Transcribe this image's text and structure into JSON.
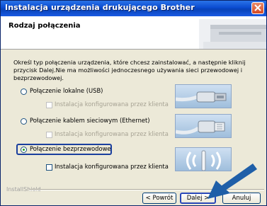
{
  "window": {
    "title": "Instalacja urządzenia drukującego Brother"
  },
  "header": {
    "title": "Rodzaj połączenia"
  },
  "description": "Określ typ połączenia urządzenia, które chcesz zainstalować, a następnie kliknij przycisk Dalej.Nie ma możliwości jednoczesnego używania sieci przewodowej i bezprzewodowej.",
  "options": [
    {
      "label": "Połączenie lokalne (USB)",
      "selected": false,
      "sub_label": "Instalacja konfigurowana przez klienta",
      "sub_enabled": false
    },
    {
      "label": "Połączenie kablem sieciowym (Ethernet)",
      "selected": false,
      "sub_label": "Instalacja konfigurowana przez klienta",
      "sub_enabled": false
    },
    {
      "label": "Połączenie bezprzewodowe",
      "selected": true,
      "sub_label": "Instalacja konfigurowana przez klienta",
      "sub_enabled": true
    }
  ],
  "footer": {
    "brand": "InstallShield",
    "back_label": "< Powrót",
    "next_label": "Dalej >",
    "cancel_label": "Anuluj"
  },
  "colors": {
    "titlebar": "#0a4bd0",
    "dialog_bg": "#ece9d8",
    "arrow": "#1f5fa8"
  },
  "icons": {
    "close": "close-icon",
    "usb": "usb-cable-icon",
    "ethernet": "ethernet-cable-icon",
    "wireless": "wireless-signal-icon",
    "pointer": "pointer-arrow"
  }
}
